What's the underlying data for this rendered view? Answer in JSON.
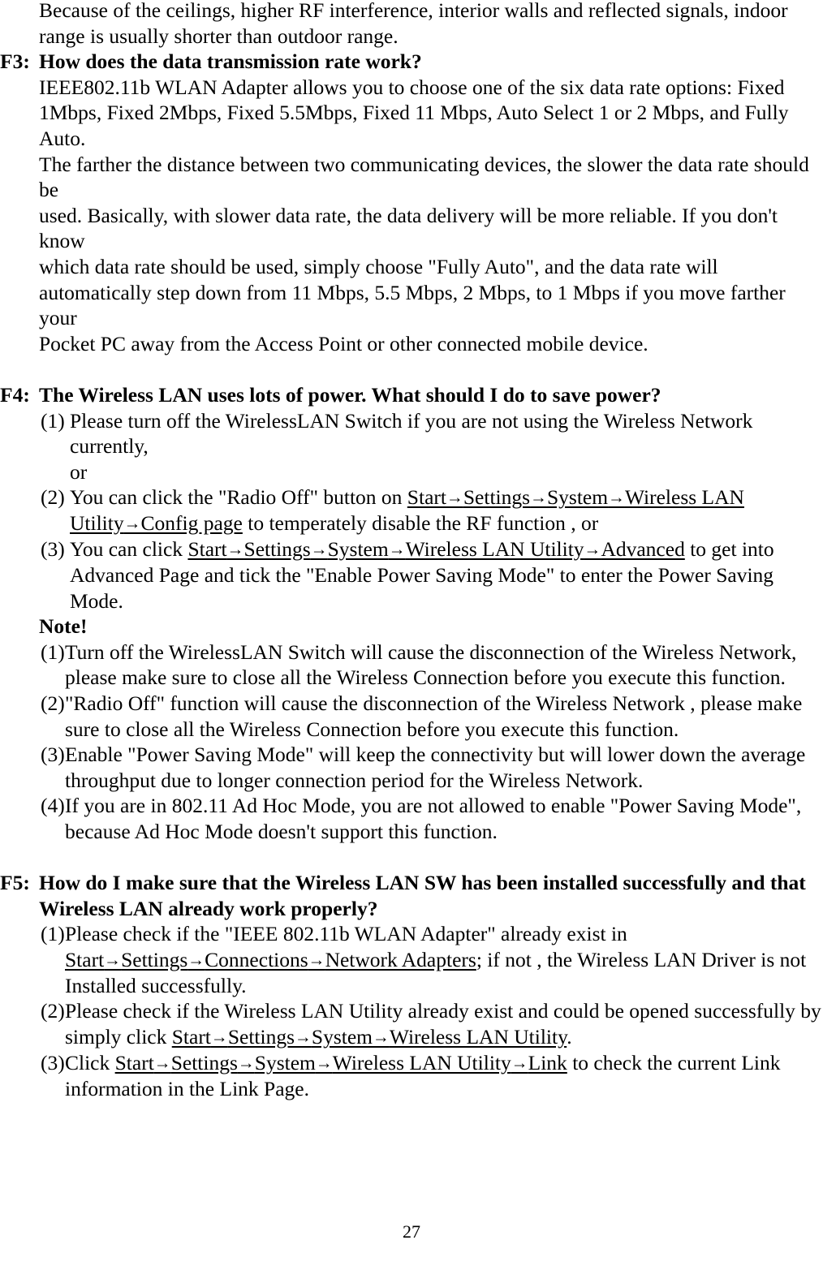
{
  "document": {
    "page_number": "27",
    "arrow_glyph": "→"
  },
  "intro_paragraph": {
    "line1": "Because of the ceilings, higher RF interference, interior walls and reflected signals, indoor",
    "line2": "range is usually shorter than outdoor range."
  },
  "f3": {
    "marker": "F3:",
    "question": "How does the data transmission rate work?",
    "answer_line1": "IEEE802.11b WLAN Adapter allows you to choose one of the six data rate options: Fixed",
    "answer_line2": "1Mbps, Fixed 2Mbps, Fixed 5.5Mbps, Fixed 11 Mbps, Auto Select 1 or 2 Mbps, and Fully Auto.",
    "answer_line3": "The farther the distance between two communicating devices, the slower the data rate should be",
    "answer_line4": "used. Basically, with slower data rate, the data delivery will be more reliable. If you don't know",
    "answer_line5": "which data rate should be used, simply choose \"Fully Auto\", and the data rate will",
    "answer_line6": "automatically step down from 11 Mbps, 5.5 Mbps, 2 Mbps, to 1 Mbps if you move farther your",
    "answer_line7": "Pocket PC away from the Access Point or other connected mobile device."
  },
  "f4": {
    "marker": "F4:",
    "question": "The Wireless LAN uses lots of power. What should I do to save power?",
    "items": [
      {
        "marker": "(1)",
        "text_a": "Please turn off the WirelessLAN Switch if you are not using the Wireless Network currently,",
        "text_b": "or"
      },
      {
        "marker": "(2)",
        "pre": "You can click the \"Radio Off\" button on ",
        "path": "Start→Settings→System→Wireless LAN Utility→Config page",
        "post": " to temperately disable the RF function , or"
      },
      {
        "marker": "(3)",
        "pre": "You can click ",
        "path": "Start→Settings→System→Wireless LAN Utility→Advanced",
        "post": " to get into Advanced Page and tick the \"Enable Power Saving Mode\" to enter the Power Saving Mode."
      }
    ],
    "note_heading": "Note!",
    "notes": [
      {
        "marker": "(1)",
        "text": "Turn off the WirelessLAN Switch will cause the disconnection of the Wireless Network, please make sure to close all the Wireless Connection before you execute this function."
      },
      {
        "marker": "(2)",
        "text": "\"Radio Off\" function will cause the disconnection of the Wireless Network , please make sure to close all the Wireless Connection before you execute this function."
      },
      {
        "marker": "(3)",
        "text": "Enable \"Power Saving Mode\" will keep the connectivity but will lower down the average throughput due to longer connection period for the Wireless Network."
      },
      {
        "marker": "(4)",
        "text": "If you are in 802.11 Ad Hoc Mode, you are not allowed to enable \"Power Saving Mode\", because Ad Hoc Mode doesn't support this function."
      }
    ]
  },
  "f5": {
    "marker": "F5:",
    "question_line1": "How do I make sure that the Wireless LAN SW has been installed successfully and that",
    "question_line2": "Wireless LAN already work properly?",
    "items": [
      {
        "marker": "(1)",
        "pre": "Please check if the \"IEEE 802.11b WLAN Adapter\" already exist in ",
        "path": "Start→Settings→Connections→Network Adapters",
        "post": "; if not , the Wireless LAN Driver is not Installed successfully."
      },
      {
        "marker": "(2)",
        "pre": "Please check if the Wireless LAN Utility already exist and could be opened successfully by simply click ",
        "path": "Start→Settings→System→Wireless LAN Utility",
        "post": "."
      },
      {
        "marker": "(3)",
        "pre": "Click ",
        "path": "Start→Settings→System→Wireless LAN Utility→Link",
        "post": " to check the current Link information in the Link Page."
      }
    ]
  }
}
